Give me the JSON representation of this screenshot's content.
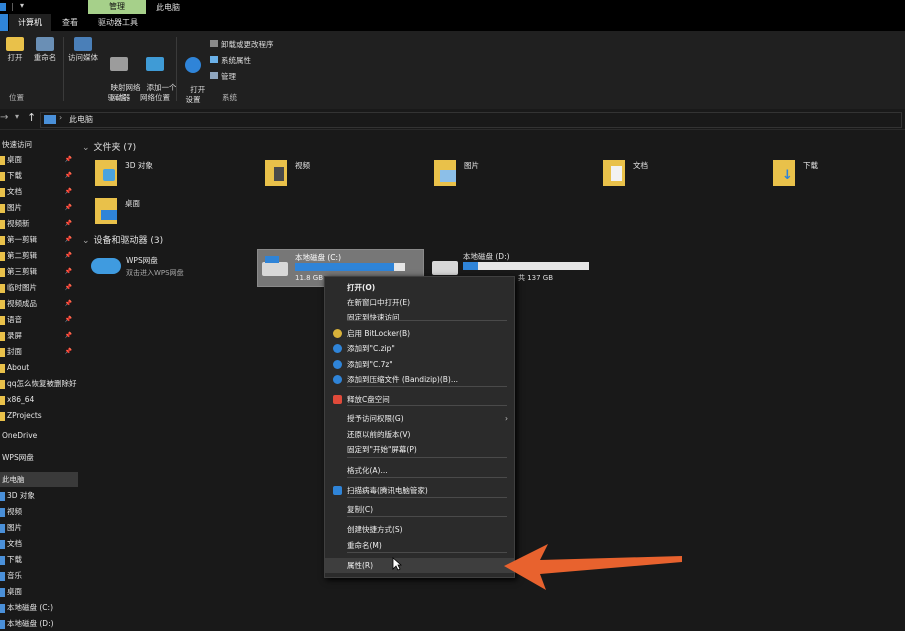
{
  "titlebar": {
    "manage_tab": "管理",
    "location": "此电脑"
  },
  "tabs": [
    "计算机",
    "查看",
    "驱动器工具"
  ],
  "ribbon": {
    "groups": [
      "位置",
      "网络",
      "系统"
    ],
    "location_buttons": [
      "打开",
      "重命名"
    ],
    "network_buttons": [
      "访问媒体",
      "映射网络\n驱动器",
      "添加一个\n网络位置"
    ],
    "system_button": "打开\n设置",
    "system_links": [
      "卸载或更改程序",
      "系统属性",
      "管理"
    ]
  },
  "address": {
    "path": "此电脑"
  },
  "sidebar": {
    "items": [
      {
        "label": "快速访问",
        "pin": false,
        "type": "header"
      },
      {
        "label": "桌面",
        "pin": true
      },
      {
        "label": "下载",
        "pin": true
      },
      {
        "label": "文档",
        "pin": true
      },
      {
        "label": "图片",
        "pin": true
      },
      {
        "label": "视频新",
        "pin": true
      },
      {
        "label": "第一剪辑",
        "pin": true
      },
      {
        "label": "第二剪辑",
        "pin": true
      },
      {
        "label": "第三剪辑",
        "pin": true
      },
      {
        "label": "临时图片",
        "pin": true
      },
      {
        "label": "视频成品",
        "pin": true
      },
      {
        "label": "语音",
        "pin": true
      },
      {
        "label": "录屏",
        "pin": true
      },
      {
        "label": "封面",
        "pin": true
      },
      {
        "label": "About",
        "pin": false
      },
      {
        "label": "qq怎么恢复被删除好",
        "pin": false
      },
      {
        "label": "x86_64",
        "pin": false
      },
      {
        "label": "ZProjects",
        "pin": false
      },
      {
        "label": "OneDrive",
        "pin": false,
        "type": "header"
      },
      {
        "label": "WPS网盘",
        "pin": false,
        "type": "header"
      },
      {
        "label": "此电脑",
        "pin": false,
        "type": "header"
      },
      {
        "label": "3D 对象",
        "pin": false
      },
      {
        "label": "视频",
        "pin": false
      },
      {
        "label": "图片",
        "pin": false
      },
      {
        "label": "文档",
        "pin": false
      },
      {
        "label": "下载",
        "pin": false
      },
      {
        "label": "音乐",
        "pin": false
      },
      {
        "label": "桌面",
        "pin": false
      },
      {
        "label": "本地磁盘 (C:)",
        "pin": false
      },
      {
        "label": "本地磁盘 (D:)",
        "pin": false
      }
    ]
  },
  "folders": {
    "header": "文件夹 (7)",
    "items": [
      "3D 对象",
      "视频",
      "图片",
      "文档",
      "下载",
      "桌面"
    ]
  },
  "devices": {
    "header": "设备和驱动器 (3)",
    "wps": {
      "name": "WPS网盘",
      "sub": "双击进入WPS网盘"
    },
    "c_drive": {
      "name": "本地磁盘 (C:)",
      "info": "11.8 GB",
      "fill": 0.9
    },
    "d_drive": {
      "name": "本地磁盘 (D:)",
      "info": "共 137 GB",
      "fill": 0.12
    }
  },
  "context_menu": {
    "items": [
      {
        "label": "打开(O)",
        "bold": true
      },
      {
        "label": "在新窗口中打开(E)"
      },
      {
        "label": "固定到快速访问"
      },
      {
        "label": "启用 BitLocker(B)",
        "icon": "bitlocker-icon"
      },
      {
        "label": "添加到\"C.zip\"",
        "icon": "bandizip-icon"
      },
      {
        "label": "添加到\"C.7z\"",
        "icon": "bandizip-icon"
      },
      {
        "label": "添加到压缩文件 (Bandizip)(B)...",
        "icon": "bandizip-icon"
      },
      {
        "label": "释放C盘空间",
        "icon": "cleanup-icon"
      },
      {
        "label": "授予访问权限(G)",
        "submenu": true
      },
      {
        "label": "还原以前的版本(V)"
      },
      {
        "label": "固定到\"开始\"屏幕(P)"
      },
      {
        "label": "格式化(A)..."
      },
      {
        "label": "扫描病毒(腾讯电脑管家)",
        "icon": "shield-icon"
      },
      {
        "label": "复制(C)"
      },
      {
        "label": "创建快捷方式(S)"
      },
      {
        "label": "重命名(M)"
      },
      {
        "label": "属性(R)"
      }
    ]
  },
  "colors": {
    "accent": "#2f84d8",
    "arrow": "#e8622e",
    "ribbon_tab": "#a6d08a",
    "folder": "#e9c14a"
  }
}
